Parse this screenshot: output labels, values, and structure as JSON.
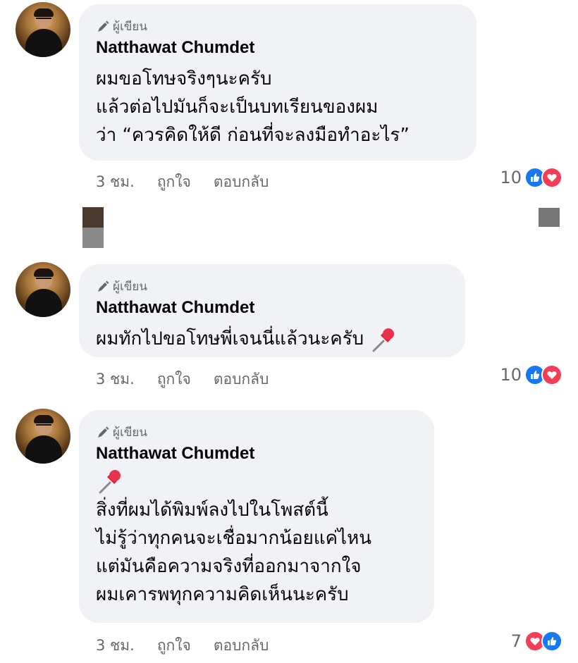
{
  "comments": [
    {
      "badge": "ผู้เขียน",
      "author": "Natthawat Chumdet",
      "lines": [
        "ผมขอโทษจริงๆนะครับ",
        "แล้วต่อไปมันก็จะเป็นบทเรียนของผม",
        "ว่า “ควรคิดให้ดี ก่อนที่จะลงมือทำอะไร”"
      ],
      "time": "3 ชม.",
      "like_label": "ถูกใจ",
      "reply_label": "ตอบกลับ",
      "reaction_count": "10",
      "reaction_icons": [
        "like-icon",
        "love-icon"
      ]
    },
    {
      "badge": "ผู้เขียน",
      "author": "Natthawat Chumdet",
      "lines": [
        "ผมทักไปขอโทษพี่เจนนี่แล้วนะครับ"
      ],
      "emoji": "pushpin-icon",
      "time": "3 ชม.",
      "like_label": "ถูกใจ",
      "reply_label": "ตอบกลับ",
      "reaction_count": "10",
      "reaction_icons": [
        "like-icon",
        "love-icon"
      ]
    },
    {
      "badge": "ผู้เขียน",
      "author": "Natthawat Chumdet",
      "emoji": "pushpin-icon",
      "lines": [
        "สิ่งที่ผมได้พิมพ์ลงไปในโพสต์นี้",
        "ไม่รู้ว่าทุกคนจะเชื่อมากน้อยแค่ไหน",
        "แต่มันคือความจริงที่ออกมาจากใจ",
        "ผมเคารพทุกความคิดเห็นนะครับ"
      ],
      "time": "3 ชม.",
      "like_label": "ถูกใจ",
      "reply_label": "ตอบกลับ",
      "reaction_count": "7",
      "reaction_icons": [
        "love-icon",
        "like-icon"
      ]
    }
  ],
  "colors": {
    "bubble": "#f0f2f5",
    "like": "#1877f2",
    "love": "#f33e58",
    "meta": "#65676b"
  }
}
